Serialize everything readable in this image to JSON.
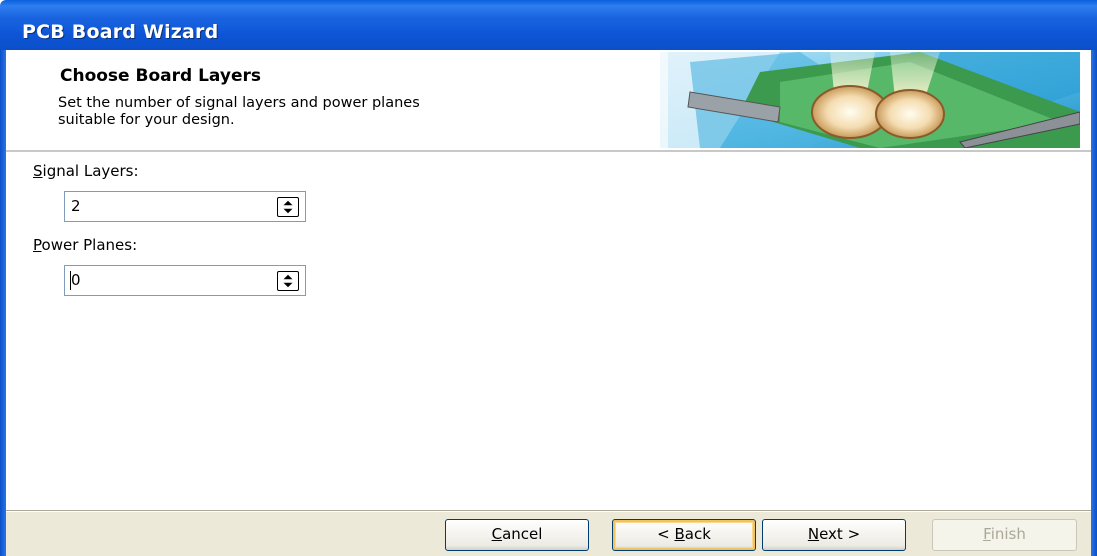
{
  "window": {
    "title": "PCB Board Wizard"
  },
  "header": {
    "heading": "Choose Board Layers",
    "description_line1": "Set the number of signal layers and power planes",
    "description_line2": "suitable for your design."
  },
  "fields": {
    "signal_layers": {
      "label_mnemonic": "S",
      "label_rest": "ignal Layers:",
      "value": "2"
    },
    "power_planes": {
      "label_mnemonic": "P",
      "label_rest": "ower Planes:",
      "value": "0"
    }
  },
  "buttons": {
    "cancel": {
      "mnemonic": "C",
      "rest": "ancel"
    },
    "back": {
      "prefix": "< ",
      "mnemonic": "B",
      "rest": "ack"
    },
    "next": {
      "prefix": "",
      "mnemonic": "N",
      "rest": "ext >"
    },
    "finish": {
      "mnemonic": "F",
      "rest": "inish"
    }
  },
  "icons": {
    "spin_up_down": "spin-updown-icon",
    "banner_image": "pcb-banner-image"
  },
  "colors": {
    "titlebar_blue": "#0d55d6",
    "footer_bg": "#ece9d8",
    "default_button_glow": "#f1c35c"
  }
}
